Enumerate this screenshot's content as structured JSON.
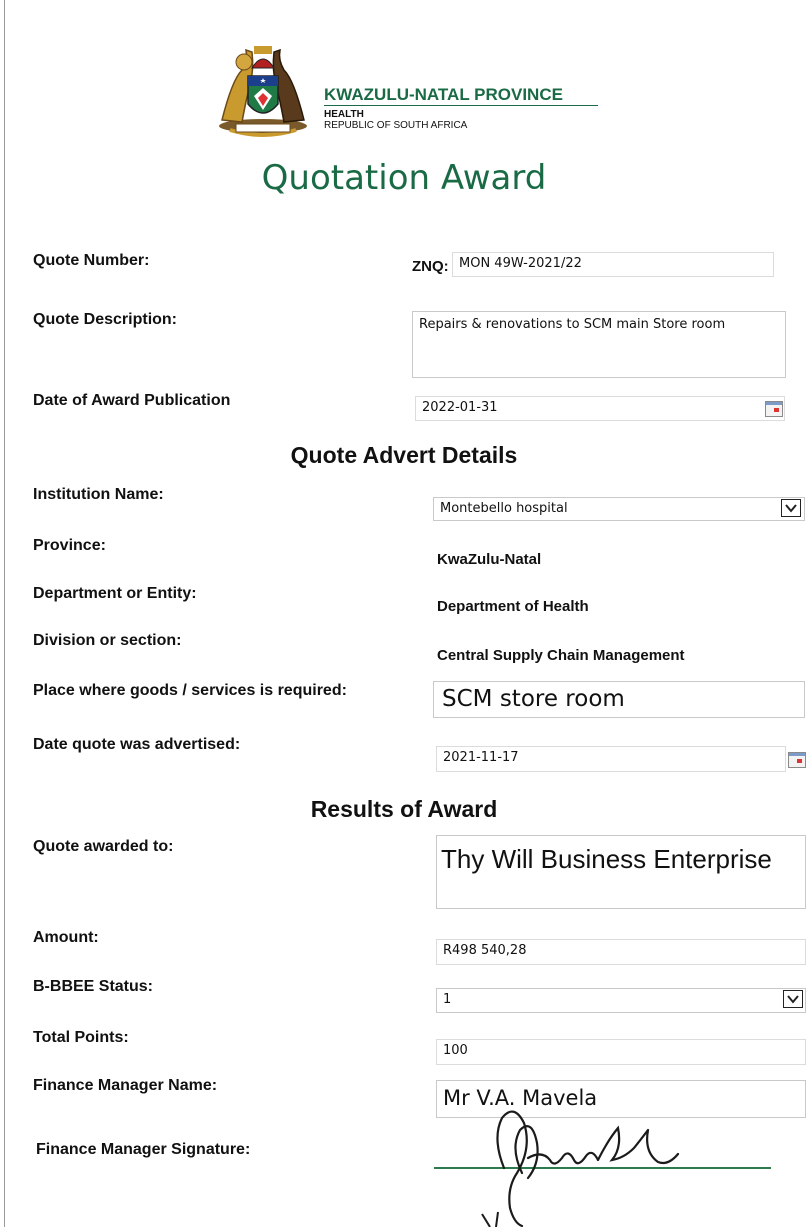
{
  "header": {
    "org_name": "KWAZULU-NATAL PROVINCE",
    "org_line2": "HEALTH",
    "org_line3": "REPUBLIC OF SOUTH AFRICA",
    "title": "Quotation Award"
  },
  "quote": {
    "number_label": "Quote Number:",
    "number_prefix": "ZNQ:",
    "number_value": "MON 49W-2021/22",
    "description_label": "Quote Description:",
    "description_value": "Repairs & renovations to SCM main Store room",
    "award_date_label": "Date of Award Publication",
    "award_date_value": "2022-01-31"
  },
  "advert": {
    "heading": "Quote Advert Details",
    "institution_label": "Institution Name:",
    "institution_value": "Montebello hospital",
    "province_label": "Province:",
    "province_value": "KwaZulu-Natal",
    "department_label": "Department or Entity:",
    "department_value": "Department of Health",
    "division_label": "Division or section:",
    "division_value": "Central Supply Chain Management",
    "place_label": "Place where goods /  services is required:",
    "place_value": "SCM store room",
    "advertised_label": "Date quote was advertised:",
    "advertised_value": "2021-11-17"
  },
  "results": {
    "heading": "Results of Award",
    "awarded_label": "Quote awarded to:",
    "awarded_value": "Thy Will Business Enterprise",
    "amount_label": "Amount:",
    "amount_value": "R498 540,28",
    "bbbee_label": "B-BBEE Status:",
    "bbbee_value": "1",
    "points_label": "Total Points:",
    "points_value": "100",
    "fm_name_label": "Finance Manager Name:",
    "fm_name_value": "Mr V.A. Mavela",
    "fm_sig_label": "Finance Manager Signature:"
  },
  "colors": {
    "title_green": "#1a6b45",
    "crest_gold": "#c99a2e",
    "signature_line": "#2d7a4f"
  }
}
